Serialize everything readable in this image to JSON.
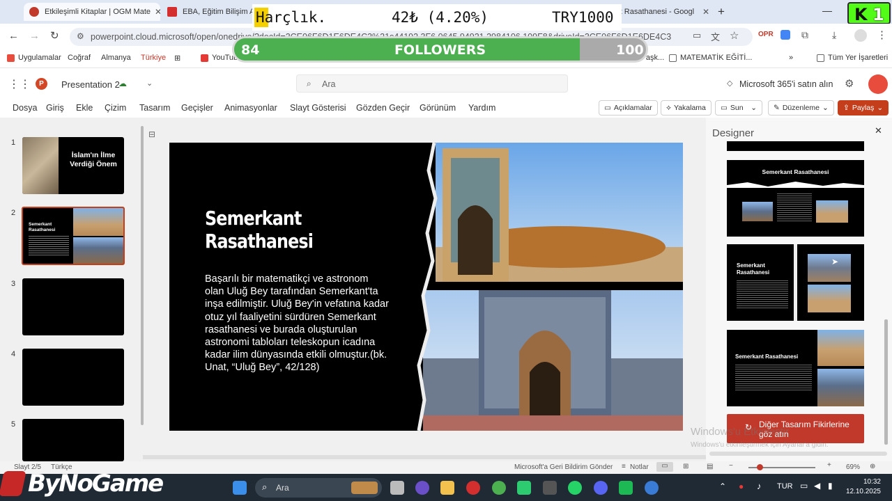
{
  "browser": {
    "tabs": [
      {
        "title": "Etkileşimli Kitaplar | OGM Mate",
        "color": "#c0392b"
      },
      {
        "title": "EBA, Eğitim Bilişim Ağı",
        "color": "#d32f2f"
      },
      {
        "title": "rt Rasathanesi - Googl",
        "color": "#4285f4"
      }
    ],
    "url": "powerpoint.cloud.microsoft/open/onedrive/?docId=3CE06F6D1E6DE4C3%21s44192 3F6 0645 94921 2984106 109F8&driveId=3CE06F6D1E6DE4C3",
    "bookmarks": [
      "Uygulamalar",
      "Coğraf",
      "Almanya",
      "Türkiye",
      "YouTube",
      "Divan edebiyatı aşk...",
      "MATEMATİK EĞİTİ...",
      "Tüm Yer İşaretleri"
    ]
  },
  "overlay": {
    "harclik_label": "Harçlık.",
    "harclik_value": "42₺ (4.20%)",
    "harclik_goal": "TRY1000",
    "followers_current": "84",
    "followers_label": "FOLLOWERS",
    "followers_goal": "100",
    "followers_progress": 0.84,
    "brand": "ByNoGame",
    "watermark_line1": "Windows'u Etkinleştir",
    "watermark_line2": "Windows'u etkinleştirmek için Ayarlar'a gidin."
  },
  "app": {
    "presentation_name": "Presentation 2",
    "search_placeholder": "Ara",
    "buy_label": "Microsoft 365'i satın alın",
    "menu": [
      "Dosya",
      "Giriş",
      "Ekle",
      "Çizim",
      "Tasarım",
      "Geçişler",
      "Animasyonlar",
      "Slayt Gösterisi",
      "Gözden Geçir",
      "Görünüm",
      "Yardım"
    ],
    "comments_label": "Açıklamalar",
    "catchup_label": "Yakalama",
    "present_label": "Sun",
    "editing_label": "Düzenleme",
    "share_label": "Paylaş"
  },
  "thumbnails": [
    {
      "num": "1",
      "title": "İslam'ın İlme Verdiği Önem"
    },
    {
      "num": "2",
      "title": "Semerkant Rasathanesi"
    },
    {
      "num": "3",
      "title": ""
    },
    {
      "num": "4",
      "title": ""
    },
    {
      "num": "5",
      "title": ""
    }
  ],
  "slide": {
    "title_line1": "Semerkant",
    "title_line2": "Rasathanesi",
    "body": "Başarılı bir matematikçi ve astronom olan Uluğ Bey tarafından Semerkant'ta inşa edilmiştir. Uluğ Bey'in vefatına kadar otuz yıl faaliyetini sürdüren Semerkant rasathanesi ve burada oluşturulan astronomi tabloları teleskopun icadına kadar ilim dünyasında etkili olmuştur.(bk. Unat, “Uluğ Bey”, 42/128)"
  },
  "designer": {
    "title": "Designer",
    "card_title": "Semerkant Rasathanesi",
    "more_ideas": "Diğer Tasarım Fikirlerine göz atın"
  },
  "status": {
    "slide_counter": "Slayt 2/5",
    "language": "Türkçe",
    "feedback": "Microsoft'a Geri Bildirim Gönder",
    "notes": "Notlar",
    "zoom": "69%"
  },
  "taskbar": {
    "search": "Ara",
    "lang": "TUR",
    "time": "10:32",
    "date": "12.10.2025"
  }
}
